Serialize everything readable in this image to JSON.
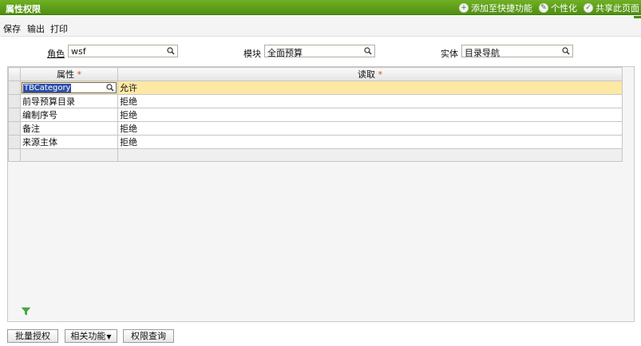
{
  "window": {
    "title": "属性权限",
    "actions": [
      {
        "label": "添加至快捷功能",
        "icon": "add-shortcut-icon"
      },
      {
        "label": "个性化",
        "icon": "pencil-icon"
      },
      {
        "label": "共享此页面",
        "icon": "check-icon"
      }
    ]
  },
  "toolbar": {
    "save_label": "保存",
    "export_label": "输出",
    "print_label": "打印"
  },
  "filters": {
    "role_label": "角色",
    "role_value": "wsf",
    "module_label": "模块",
    "module_value": "全面预算",
    "entity_label": "实体",
    "entity_value": "目录导航"
  },
  "grid": {
    "col_attribute": "属性",
    "col_read": "读取",
    "required_mark": "*",
    "rows": [
      {
        "attribute": "TBCategory",
        "read": "允许"
      },
      {
        "attribute": "前导预算目录",
        "read": "拒绝"
      },
      {
        "attribute": "编制序号",
        "read": "拒绝"
      },
      {
        "attribute": "备注",
        "read": "拒绝"
      },
      {
        "attribute": "来源主体",
        "read": "拒绝"
      }
    ]
  },
  "buttons": {
    "batch_authorize": "批量授权",
    "related_functions": "相关功能",
    "permission_query": "权限查询"
  },
  "colors": {
    "titlebar": "#5c9d1a",
    "selected_row": "#fde9a4",
    "required": "#e04b00",
    "filter_icon": "#3fae3a"
  }
}
